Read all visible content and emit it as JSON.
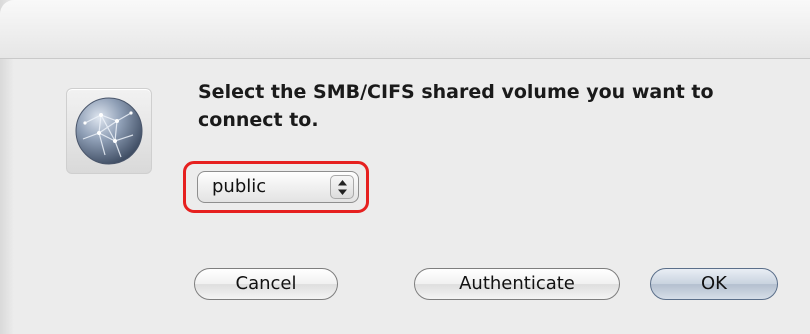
{
  "dialog": {
    "message": "Select the SMB/CIFS shared volume you want to connect to.",
    "volume_select": {
      "selected": "public"
    },
    "buttons": {
      "cancel": "Cancel",
      "authenticate": "Authenticate",
      "ok": "OK"
    },
    "icon": "network-globe-icon",
    "highlight_color": "#e6201f"
  }
}
